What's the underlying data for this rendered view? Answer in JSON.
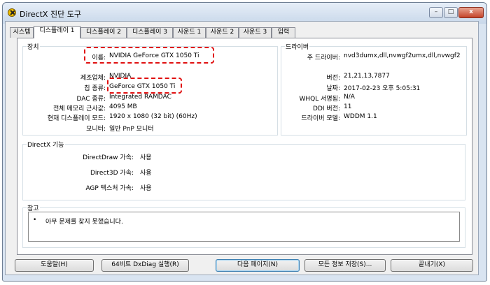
{
  "window": {
    "title": "DirectX 진단 도구"
  },
  "controls": {
    "minimize": "–",
    "maximize": "□",
    "close": "x"
  },
  "tabs": [
    "시스템",
    "디스플레이 1",
    "디스플레이 2",
    "디스플레이 3",
    "사운드 1",
    "사운드 2",
    "사운드 3",
    "입력"
  ],
  "device": {
    "section_label": "장치",
    "rows": [
      {
        "label": "이름:",
        "value": "NVIDIA GeForce GTX 1050 Ti"
      },
      {
        "label": "제조업체:",
        "value": "NVIDIA"
      },
      {
        "label": "칩 종류:",
        "value": "GeForce GTX 1050 Ti"
      },
      {
        "label": "DAC 종류:",
        "value": "Integrated RAMDAC"
      },
      {
        "label": "전체 메모리 근사값:",
        "value": "4095 MB"
      },
      {
        "label": "현재 디스플레이 모드:",
        "value": "1920 x 1080 (32 bit) (60Hz)"
      },
      {
        "label": "모니터:",
        "value": "일반 PnP 모니터"
      }
    ]
  },
  "driver": {
    "section_label": "드라이버",
    "rows": [
      {
        "label": "주 드라이버:",
        "value": "nvd3dumx,dll,nvwgf2umx,dll,nvwgf2"
      },
      {
        "label": "버전:",
        "value": "21,21,13,7877"
      },
      {
        "label": "날짜:",
        "value": "2017-02-23 오후 5:05:31"
      },
      {
        "label": "WHQL 서명됨:",
        "value": "N/A"
      },
      {
        "label": "DDI 버전:",
        "value": "11"
      },
      {
        "label": "드라이버 모델:",
        "value": "WDDM 1.1"
      }
    ]
  },
  "directx": {
    "section_label": "DirectX 기능",
    "rows": [
      {
        "label": "DirectDraw 가속:",
        "value": "사용"
      },
      {
        "label": "Direct3D 가속:",
        "value": "사용"
      },
      {
        "label": "AGP 텍스처 가속:",
        "value": "사용"
      }
    ]
  },
  "notes": {
    "section_label": "참고",
    "bullet": "•",
    "text": "아무 문제를 찾지 못했습니다."
  },
  "buttons": {
    "help": "도움말(H)",
    "dxdiag64": "64비트 DxDiag 실행(R)",
    "next_page": "다음 페이지(N)",
    "save_all": "모든 정보 저장(S)...",
    "exit": "끝내기(X)"
  },
  "colors": {
    "highlight": "#e01010",
    "window_frame": "#d9e4f1"
  }
}
